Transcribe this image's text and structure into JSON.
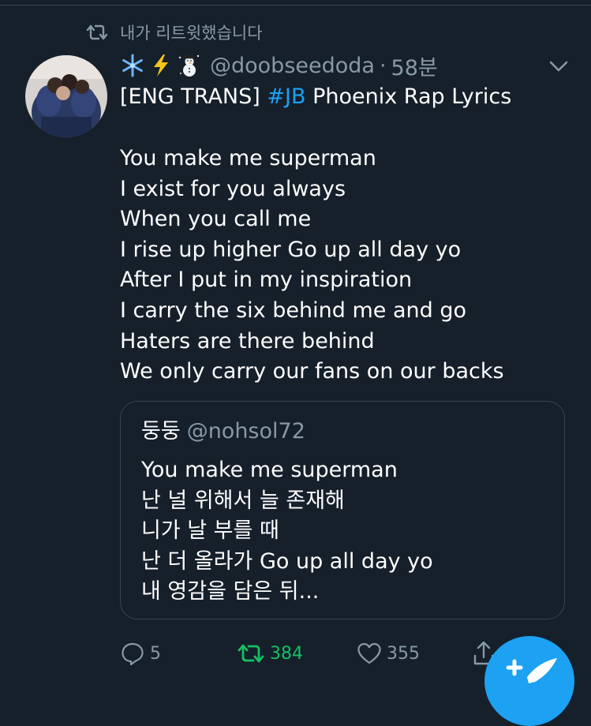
{
  "retweet_label": "내가 리트윗했습니다",
  "tweet": {
    "author_emojis": [
      "snowflake",
      "lightning",
      "snowman"
    ],
    "handle": "@doobseedoda",
    "separator": "·",
    "time": "58분",
    "title_prefix": "[ENG TRANS] ",
    "hashtag": "#JB",
    "title_suffix": " Phoenix Rap Lyrics",
    "lines": [
      "You make me superman",
      "I exist for you always",
      "When you call me",
      "I rise up higher Go up all day yo",
      "After I put in my inspiration",
      "I carry the six behind me and go",
      "Haters are there behind",
      "We only carry our fans on our backs"
    ]
  },
  "quote": {
    "name": "둥둥",
    "handle": "@nohsol72",
    "lines": [
      "You make me superman",
      "난 널 위해서 늘 존재해",
      "니가 날 부를 때",
      "난 더 올라가 Go up all day yo",
      "내 영감을 담은 뒤..."
    ]
  },
  "actions": {
    "reply_count": "5",
    "retweet_count": "384",
    "like_count": "355"
  },
  "colors": {
    "background": "#15202b",
    "muted_text": "#8899a6",
    "accent_blue": "#1da1f2",
    "retweet_green": "#17bf63",
    "border": "#38444d"
  },
  "icons": [
    "retweet-icon",
    "chevron-down-icon",
    "reply-icon",
    "like-icon",
    "share-icon",
    "compose-icon"
  ]
}
